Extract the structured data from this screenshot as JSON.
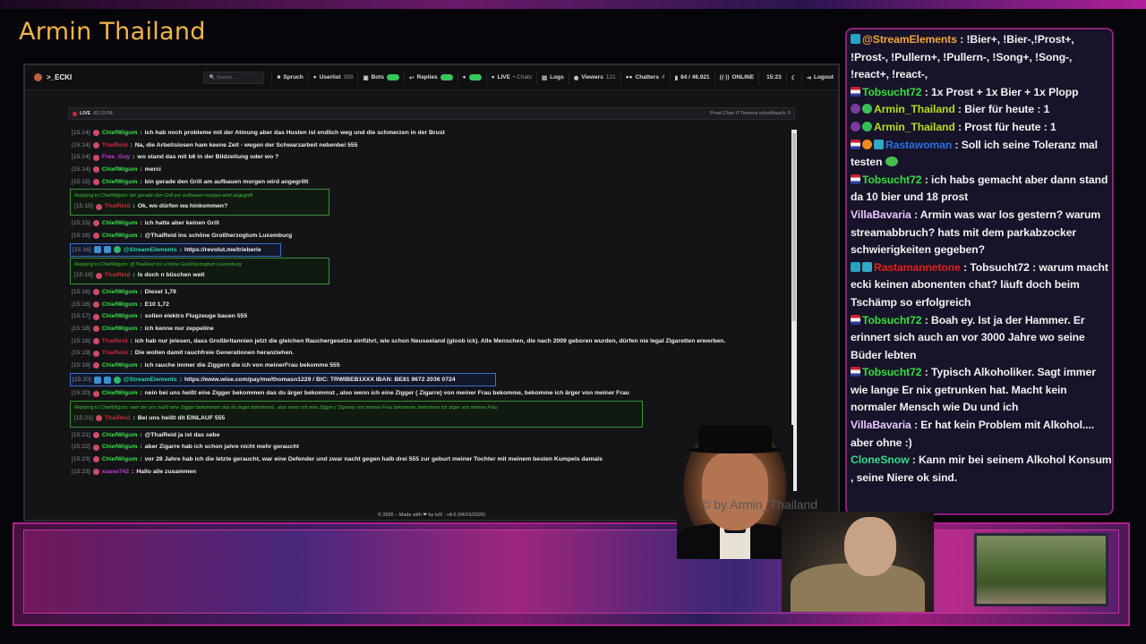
{
  "brand": {
    "title": "Armin Thailand"
  },
  "app": {
    "logo": ">_ECKI",
    "search_placeholder": "Search...",
    "nav": [
      {
        "icon": "speech-icon",
        "label": "Spruch",
        "count": ""
      },
      {
        "icon": "user-icon",
        "label": "Userlist",
        "count": "393"
      },
      {
        "icon": "robot-icon",
        "label": "Bots",
        "count": ""
      },
      {
        "icon": "reply-icon",
        "label": "Replies",
        "count": ""
      },
      {
        "icon": "mic-icon",
        "label": "",
        "count": ""
      },
      {
        "icon": "live-icon",
        "label": "LIVE",
        "count": "• Chats"
      },
      {
        "icon": "logs-icon",
        "label": "Logs",
        "count": ""
      },
      {
        "icon": "eye-icon",
        "label": "Viewers",
        "count": "121"
      },
      {
        "icon": "users-icon",
        "label": "Chatters",
        "count": "4"
      },
      {
        "icon": "chart-icon",
        "label": "84 / 46.921",
        "count": ""
      },
      {
        "icon": "signal-icon",
        "label": "ONLINE",
        "count": ""
      },
      {
        "icon": "clock-icon",
        "label": "15:23",
        "count": ""
      },
      {
        "icon": "moon-icon",
        "label": "",
        "count": ""
      },
      {
        "icon": "logout-icon",
        "label": "Logout",
        "count": ""
      }
    ],
    "status": {
      "live": "LIVE",
      "uptime": "00:22:58",
      "right": "Prost Chat: 0  Timeout schnittlauch: 0"
    },
    "footer": "© 2026 – Made with ❤ by tcR · v4.0 (04/16/2026)"
  },
  "chat": [
    {
      "ts": "[15:14]",
      "user": "ChiefWigum",
      "color": "green",
      "text": "ich hab noch probleme mit der Atmung aber das Husten ist endlich weg und die schmerzen in der Brust"
    },
    {
      "ts": "[15:14]",
      "user": "ThaiReid",
      "color": "red",
      "text": "Na, die Arbeitslosen ham keene Zeit - wegen der Schwarzarbeit nebenbei 555"
    },
    {
      "ts": "[15:14]",
      "user": "Free_Guy",
      "color": "mag",
      "text": "wo stand das mit b6 in der Bildzeitung oder wo ?"
    },
    {
      "ts": "[15:14]",
      "user": "ChiefWigum",
      "color": "green",
      "text": "merci"
    },
    {
      "ts": "[15:15]",
      "user": "ChiefWigum",
      "color": "green",
      "text": "bin gerade den Grill am aufbauen morgen wird angegrillt"
    }
  ],
  "reply1": {
    "header": "Replying to ChiefWigum: bin gerade den Grill am aufbauen morgen wird angegrillt",
    "ts": "[15:15]",
    "user": "ThaiReid",
    "text": "Ok, wo dürfen wa hinkommen?"
  },
  "chat2": [
    {
      "ts": "[15:15]",
      "user": "ChiefWigum",
      "color": "green",
      "text": "ich hatte aber keinen Grill"
    },
    {
      "ts": "[15:16]",
      "user": "ChiefWigum",
      "color": "green",
      "text": "@ThaiReid ins schöne Großherzogtum Luxemburg"
    }
  ],
  "se1": {
    "ts": "[15:16]",
    "user": "@StreamElements",
    "text": "https://revolut.me/trieberle"
  },
  "reply2": {
    "header": "Replying to ChiefWigum: @ThaiReid ins schöne Großherzogtum Luxemburg",
    "ts": "[15:16]",
    "user": "ThaiReid",
    "text": "Is doch n büschen weit"
  },
  "chat3": [
    {
      "ts": "[15:16]",
      "user": "ChiefWigum",
      "color": "green",
      "text": "Diesel 1,79"
    },
    {
      "ts": "[15:16]",
      "user": "ChiefWigum",
      "color": "green",
      "text": "E10 1,72"
    },
    {
      "ts": "[15:17]",
      "user": "ChiefWigum",
      "color": "green",
      "text": "sollen elektro Flugzeuge bauen 555"
    },
    {
      "ts": "[15:18]",
      "user": "ChiefWigum",
      "color": "green",
      "text": "ich kenne nur zeppeline"
    },
    {
      "ts": "[15:18]",
      "user": "ThaiReid",
      "color": "red",
      "text": "ich hab nur jelesen, dass Großbritannien jetzt die gleichen Rauchergesetze einführt, wie schon Neuseeland (gloob ick). Alle Menschen, die nach 2009 geboren wurden, dürfen nie legal Zigaretten erwerben."
    },
    {
      "ts": "[15:19]",
      "user": "ThaiReid",
      "color": "red",
      "text": "Die wollen damit rauchfreie Generationen heranziehen."
    },
    {
      "ts": "[15:19]",
      "user": "ChiefWigum",
      "color": "green",
      "text": "ich rauche immer die Ziggern die ich von meinerFrau bekomme 555"
    }
  ],
  "se2": {
    "ts": "[15:20]",
    "user": "@StreamElements",
    "text": "https://www.wise.com/pay/me/thomasn1229 / BIC: TRWIBEB1XXX IBAN: BE81 9672 2036 0724"
  },
  "chat4": [
    {
      "ts": "[15:20]",
      "user": "ChiefWigum",
      "color": "green",
      "text": "nein bei uns heißt eine Zigger bekommen das du ärger bekommst , also wenn ich eine Zigger ( Zigarre) von meiner Frau bekomme, bekomme ich ärger von meiner Frau"
    }
  ],
  "reply3": {
    "header": "Replying to ChiefWigum: nein bei uns heißt eine Zigger bekommen das du ärger bekommst , also wenn ich eine Zigger ( Zigarre) von meiner Frau bekomme, bekomme ich ärger von meiner Frau",
    "ts": "[15:21]",
    "user": "ThaiReid",
    "text": "Bei uns heißt dit EINLAUF 555"
  },
  "chat5": [
    {
      "ts": "[15:21]",
      "user": "ChiefWigum",
      "color": "green",
      "text": "@ThaiReid ja ist das sebe"
    },
    {
      "ts": "[15:22]",
      "user": "ChiefWigum",
      "color": "green",
      "text": "aber Zigarre hab ich schon jahre nicht mehr geraucht"
    },
    {
      "ts": "[15:23]",
      "user": "ChiefWigum",
      "color": "green",
      "text": "vor 28 Jahre hab ich die letzte geraucht, war eine Defender und zwar nacht gegen halb drei 555 zur geburt meiner Tochter mit meinem besten Kumpels damals"
    },
    {
      "ts": "[15:23]",
      "user": "xaaxe742",
      "color": "mag",
      "text": "Hallo alle zusammen"
    }
  ],
  "watermark": "© by Armin_Thailand",
  "right_chat": [
    {
      "user": "@StreamElements",
      "cls": "n-se",
      "icons": [
        "ic-cyan"
      ],
      "text": "!Bier+, !Bier-,!Prost+, !Prost-, !Pullern+, !Pullern-, !Song+, !Song-, !react+, !react-,"
    },
    {
      "user": "Tobsucht72",
      "cls": "n-tob",
      "icons": [
        "ic-flag"
      ],
      "text": "1x Prost + 1x Bier + 1x Plopp"
    },
    {
      "user": "Armin_Thailand",
      "cls": "n-arm",
      "icons": [
        "ic-mod",
        "ic-green"
      ],
      "text": "Bier für heute : 1"
    },
    {
      "user": "Armin_Thailand",
      "cls": "n-arm",
      "icons": [
        "ic-mod",
        "ic-green"
      ],
      "text": "Prost für heute : 1"
    },
    {
      "user": "Rastawoman",
      "cls": "n-rasta",
      "icons": [
        "ic-flag",
        "ic-orange",
        "ic-dots"
      ],
      "text": "Soll ich seine Toleranz mal testen"
    },
    {
      "user": "Tobsucht72",
      "cls": "n-tob",
      "icons": [
        "ic-flag"
      ],
      "text": "ich habs gemacht aber dann stand da 10 bier und 18 prost"
    },
    {
      "user": "VillaBavaria",
      "cls": "n-villa",
      "icons": [],
      "text": "Armin was war los gestern? warum streamabbruch? hats mit dem parkabzocker schwierigkeiten gegeben?"
    },
    {
      "user": "Rastamannetone",
      "cls": "n-rasta2",
      "icons": [
        "ic-cyan",
        "ic-dots"
      ],
      "text": "Tobsucht72 : warum macht ecki keinen abonenten chat? läuft doch beim Tschämp so erfolgreich"
    },
    {
      "user": "Tobsucht72",
      "cls": "n-tob",
      "icons": [
        "ic-flag"
      ],
      "text": "Boah ey. Ist ja der Hammer. Er erinnert sich auch an vor 3000 Jahre wo seine Büder lebten"
    },
    {
      "user": "Tobsucht72",
      "cls": "n-tob",
      "icons": [
        "ic-flag"
      ],
      "text": "Typisch Alkoholiker. Sagt immer wie lange Er nix getrunken hat. Macht kein normaler Mensch wie Du und ich"
    },
    {
      "user": "VillaBavaria",
      "cls": "n-villa",
      "icons": [],
      "text": "Er hat kein Problem mit Alkohol.... aber ohne :)"
    },
    {
      "user": "CloneSnow",
      "cls": "n-clone",
      "icons": [],
      "text": "Kann mir bei seinem Alkohol Konsum , seine Niere ok sind."
    }
  ]
}
